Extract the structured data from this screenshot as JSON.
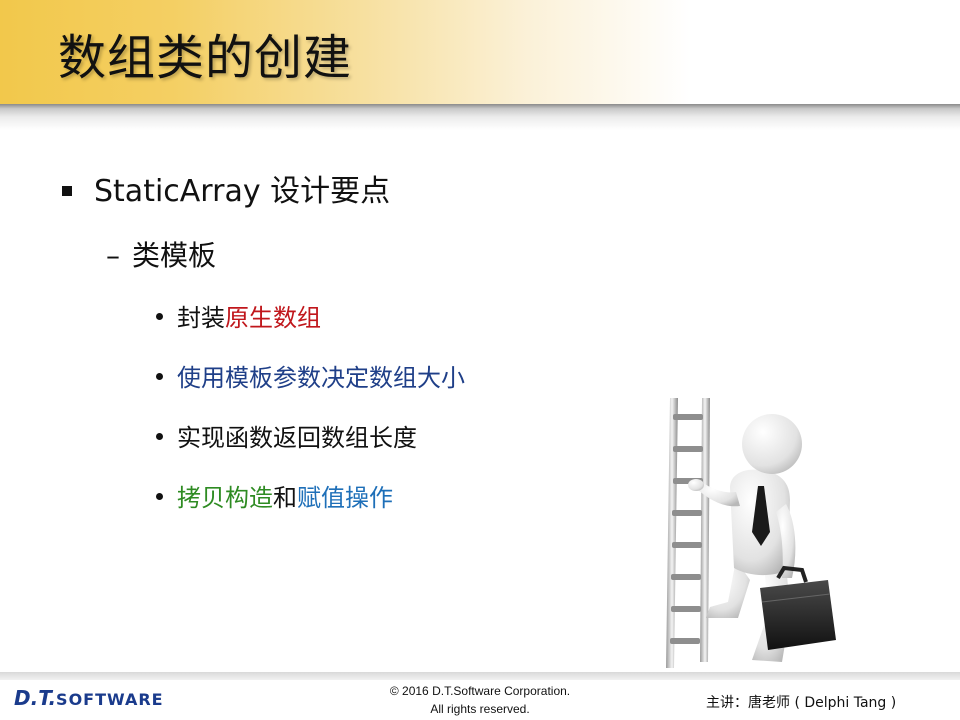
{
  "title": "数组类的创建",
  "bullets": {
    "level1": "StaticArray 设计要点",
    "level2": "类模板",
    "items": [
      {
        "parts": [
          {
            "text": "封装",
            "color": "#111111"
          },
          {
            "text": "原生数组",
            "color": "#c0161b"
          }
        ]
      },
      {
        "parts": [
          {
            "text": "使用模板参数决定数组大小",
            "color": "#1f3f88"
          }
        ]
      },
      {
        "parts": [
          {
            "text": "实现函数返回数组长度",
            "color": "#111111"
          }
        ]
      },
      {
        "parts": [
          {
            "text": "拷贝构造",
            "color": "#2e8b22"
          },
          {
            "text": "和",
            "color": "#111111"
          },
          {
            "text": "赋值操作",
            "color": "#1e6fb8"
          }
        ]
      }
    ]
  },
  "footer": {
    "logo_dt": "D.T.",
    "logo_software": "SOFTWARE",
    "copyright_line1": "© 2016 D.T.Software Corporation.",
    "copyright_line2": "All rights reserved.",
    "presenter": "主讲：唐老师 ( Delphi Tang )"
  }
}
